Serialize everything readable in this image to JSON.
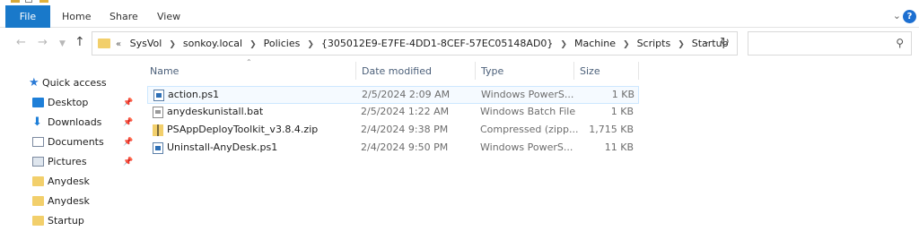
{
  "ribbon": {
    "tabs": [
      "File",
      "Home",
      "Share",
      "View"
    ],
    "help": "?",
    "expand_icon": "chevron-down-icon"
  },
  "nav": {
    "back_icon": "arrow-left-icon",
    "forward_icon": "arrow-right-icon",
    "recent_icon": "chevron-down-icon",
    "up_icon": "arrow-up-icon"
  },
  "address": {
    "lead": "«",
    "crumbs": [
      "SysVol",
      "sonkoy.local",
      "Policies",
      "{305012E9-E7FE-4DD1-8CEF-57EC05148AD0}",
      "Machine",
      "Scripts",
      "Startup"
    ]
  },
  "search": {
    "placeholder": ""
  },
  "navpane": {
    "items": [
      {
        "label": "Quick access",
        "icon": "star-icon",
        "pinned": false
      },
      {
        "label": "Desktop",
        "icon": "desktop-icon",
        "pinned": true
      },
      {
        "label": "Downloads",
        "icon": "download-icon",
        "pinned": true
      },
      {
        "label": "Documents",
        "icon": "documents-icon",
        "pinned": true
      },
      {
        "label": "Pictures",
        "icon": "pictures-icon",
        "pinned": true
      },
      {
        "label": "Anydesk",
        "icon": "folder-icon",
        "pinned": false
      },
      {
        "label": "Anydesk",
        "icon": "folder-icon",
        "pinned": false
      },
      {
        "label": "Startup",
        "icon": "folder-icon",
        "pinned": false
      }
    ]
  },
  "columns": {
    "name": "Name",
    "date": "Date modified",
    "type": "Type",
    "size": "Size"
  },
  "files": [
    {
      "name": "action.ps1",
      "date": "2/5/2024 2:09 AM",
      "type": "Windows PowerS...",
      "size": "1 KB",
      "icon": "powershell-file-icon"
    },
    {
      "name": "anydeskunistall.bat",
      "date": "2/5/2024 1:22 AM",
      "type": "Windows Batch File",
      "size": "1 KB",
      "icon": "batch-file-icon"
    },
    {
      "name": "PSAppDeployToolkit_v3.8.4.zip",
      "date": "2/4/2024 9:38 PM",
      "type": "Compressed (zipp...",
      "size": "1,715 KB",
      "icon": "zip-file-icon"
    },
    {
      "name": "Uninstall-AnyDesk.ps1",
      "date": "2/4/2024 9:50 PM",
      "type": "Windows PowerS...",
      "size": "11 KB",
      "icon": "powershell-file-icon"
    }
  ],
  "colors": {
    "accent": "#1979ca",
    "folder": "#f2cf6b",
    "selection_border": "#cde8ff"
  }
}
